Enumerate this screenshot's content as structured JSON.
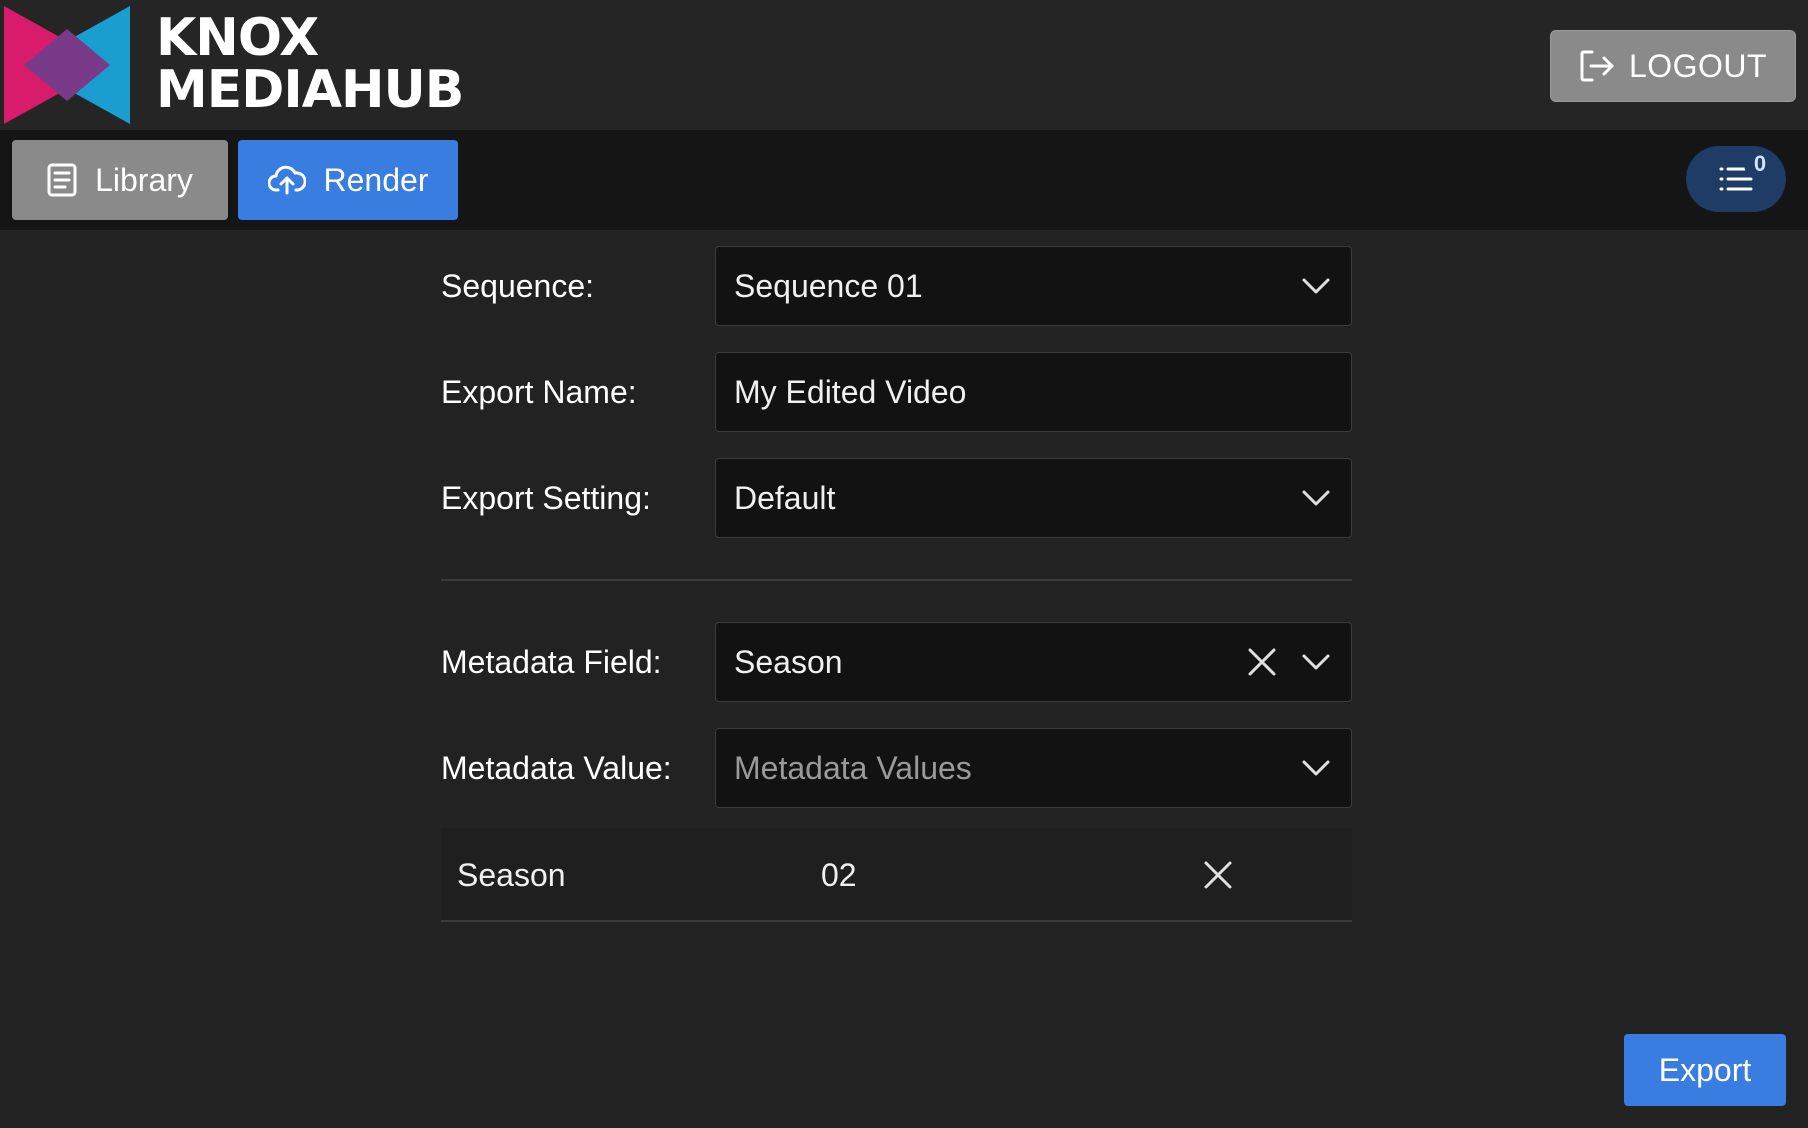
{
  "header": {
    "logo_line1": "KNOX",
    "logo_line2": "MEDIAHUB",
    "logout_label": "LOGOUT",
    "logout_icon": "logout-icon"
  },
  "nav": {
    "library_label": "Library",
    "library_icon": "document-icon",
    "render_label": "Render",
    "render_icon": "cloud-upload-icon",
    "queue_icon": "list-icon",
    "queue_count": "0"
  },
  "form": {
    "sequence": {
      "label": "Sequence:",
      "value": "Sequence 01"
    },
    "export_name": {
      "label": "Export Name:",
      "value": "My Edited Video"
    },
    "export_setting": {
      "label": "Export Setting:",
      "value": "Default"
    },
    "metadata_field": {
      "label": "Metadata Field:",
      "value": "Season"
    },
    "metadata_value": {
      "label": "Metadata Value:",
      "placeholder": "Metadata Values"
    },
    "metadata_entries": [
      {
        "field": "Season",
        "value": "02"
      }
    ]
  },
  "actions": {
    "export_label": "Export"
  },
  "colors": {
    "accent": "#3a7de0",
    "logo_pink": "#d81b6a",
    "logo_cyan": "#1a9ed0",
    "queue_bg": "#1e3c66"
  }
}
